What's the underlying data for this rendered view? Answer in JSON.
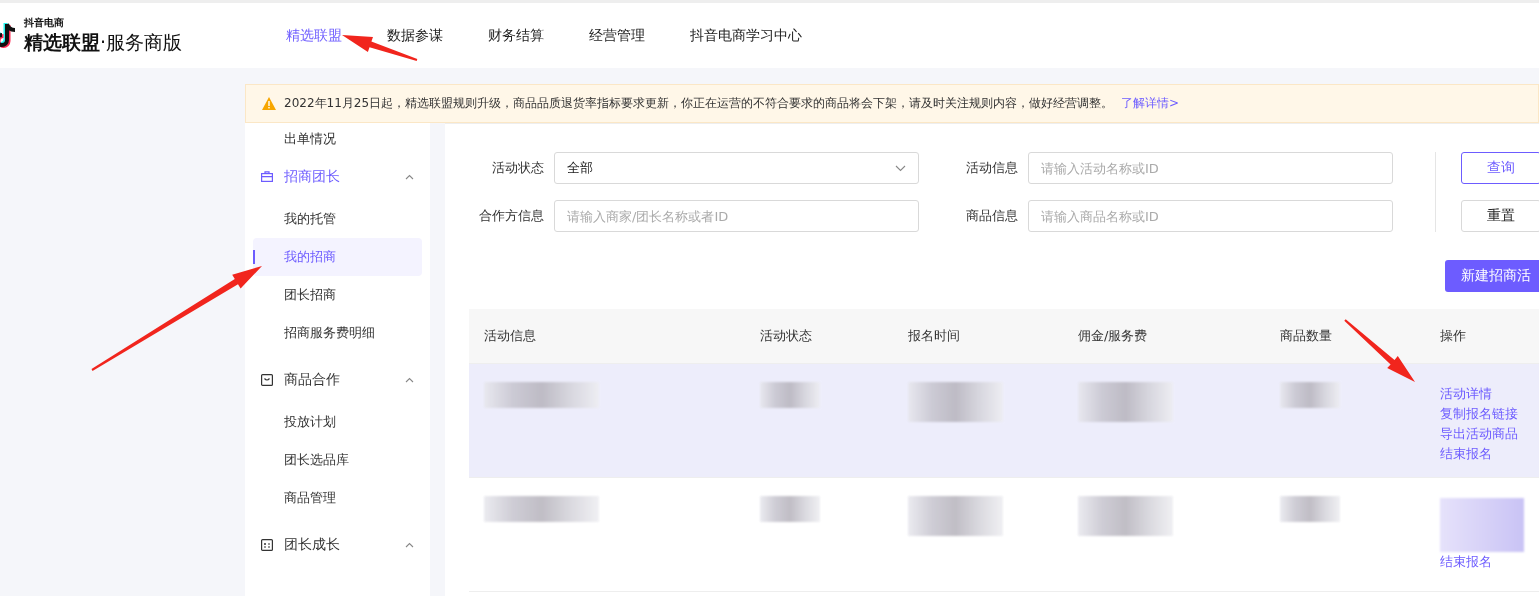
{
  "header": {
    "logo_small": "抖音电商",
    "logo_title": "精选联盟",
    "logo_subtitle": "·服务商版"
  },
  "nav": [
    {
      "label": "精选联盟",
      "selected": true
    },
    {
      "label": "数据参谋",
      "selected": false
    },
    {
      "label": "财务结算",
      "selected": false
    },
    {
      "label": "经营管理",
      "selected": false
    },
    {
      "label": "抖音电商学习中心",
      "selected": false
    }
  ],
  "notice": {
    "text": "2022年11月25日起，精选联盟规则升级，商品品质退货率指标要求更新，你正在运营的不符合要求的商品将会下架，请及时关注规则内容，做好经营调整。",
    "link": "了解详情>"
  },
  "sidebar": {
    "items": [
      {
        "kind": "item",
        "label": "出单情况",
        "selected": false
      },
      {
        "kind": "group",
        "label": "招商团长",
        "active": true,
        "expanded": true,
        "children": [
          {
            "label": "我的托管",
            "selected": false
          },
          {
            "label": "我的招商",
            "selected": true
          },
          {
            "label": "团长招商",
            "selected": false
          },
          {
            "label": "招商服务费明细",
            "selected": false
          }
        ]
      },
      {
        "kind": "group",
        "label": "商品合作",
        "active": false,
        "expanded": true,
        "children": [
          {
            "label": "投放计划",
            "selected": false
          },
          {
            "label": "团长选品库",
            "selected": false
          },
          {
            "label": "商品管理",
            "selected": false
          }
        ]
      },
      {
        "kind": "group",
        "label": "团长成长",
        "active": false,
        "expanded": true
      }
    ]
  },
  "filters": [
    {
      "kind": "select",
      "label": "活动状态",
      "value": "全部"
    },
    {
      "kind": "input",
      "label": "活动信息",
      "placeholder": "请输入活动名称或ID"
    },
    {
      "kind": "input",
      "label": "合作方信息",
      "placeholder": "请输入商家/团长名称或者ID"
    },
    {
      "kind": "input",
      "label": "商品信息",
      "placeholder": "请输入商品名称或ID"
    }
  ],
  "query_button": "查询",
  "reset_button": "重置",
  "create_button": "新建招商活",
  "table": {
    "columns": [
      "活动信息",
      "活动状态",
      "报名时间",
      "佣金/服务费",
      "商品数量",
      "操作"
    ],
    "rows": [
      {
        "highlighted": true,
        "actions_partly_hidden": false,
        "actions": [
          "活动详情",
          "复制报名链接",
          "导出活动商品",
          "结束报名"
        ]
      },
      {
        "highlighted": false,
        "actions_partly_hidden": true,
        "actions": [
          "结束报名"
        ]
      }
    ]
  }
}
